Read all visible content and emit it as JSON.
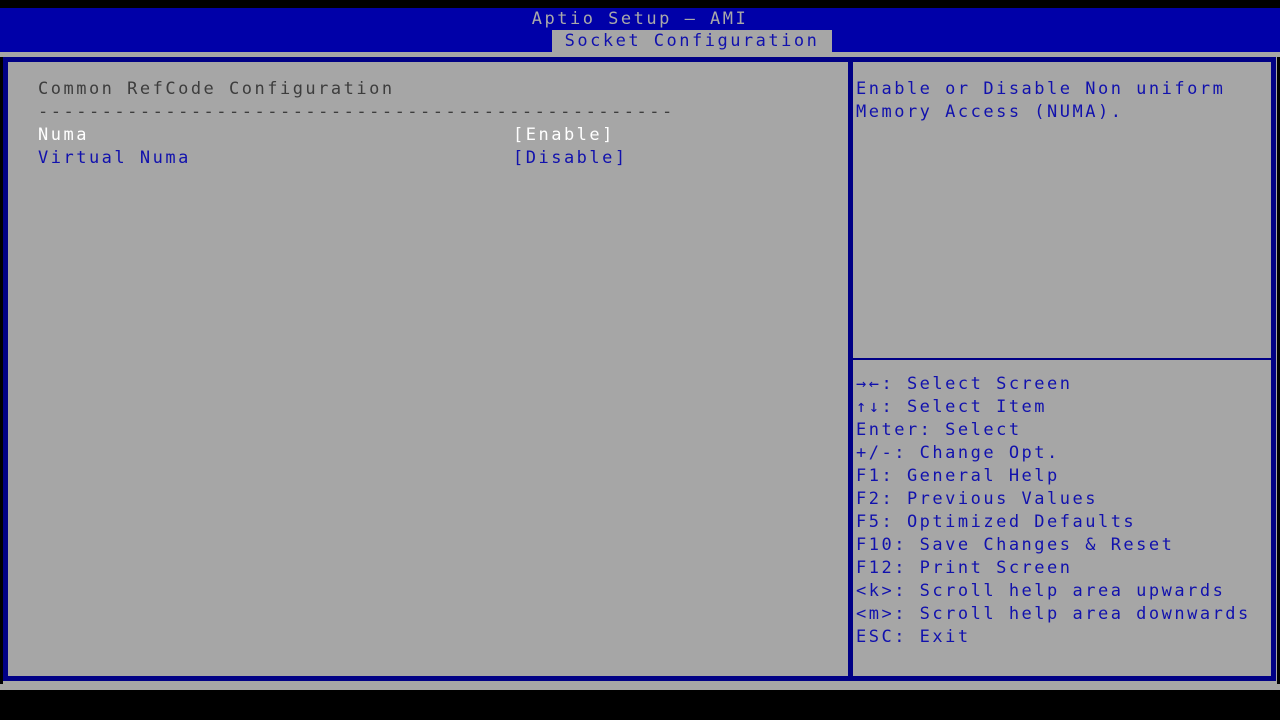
{
  "window": {
    "title": "Aptio Setup – AMI",
    "active_tab": "Socket Configuration"
  },
  "settings_panel": {
    "section_title": "Common RefCode Configuration",
    "separator": "--------------------------------------------------",
    "items": [
      {
        "label": "Numa",
        "value": "[Enable]",
        "selected": true
      },
      {
        "label": "Virtual Numa",
        "value": "[Disable]",
        "selected": false
      }
    ]
  },
  "help_panel": {
    "description_line1": "Enable or Disable Non uniform",
    "description_line2": "Memory Access (NUMA).",
    "keys": [
      "→←: Select Screen",
      "↑↓: Select Item",
      "Enter: Select",
      "+/-: Change Opt.",
      "F1: General Help",
      "F2: Previous Values",
      "F5: Optimized Defaults",
      "F10: Save Changes & Reset",
      "F12: Print Screen",
      "<k>: Scroll help area upwards",
      "<m>: Scroll help area downwards",
      "ESC: Exit"
    ]
  },
  "colors": {
    "header_blue": "#0000a8",
    "body_gray": "#a6a6a6",
    "text_blue": "#1111ad",
    "border_blue": "#000085",
    "selected_text": "#ffffff",
    "heading_text": "#3d3d3d",
    "background_black": "#000000"
  }
}
